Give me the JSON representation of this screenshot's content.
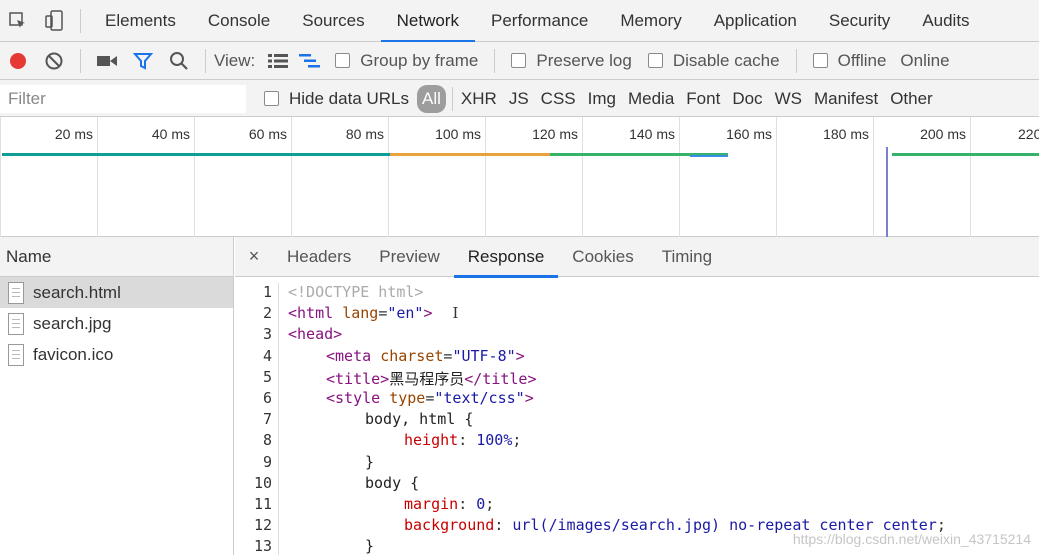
{
  "tabs": [
    "Elements",
    "Console",
    "Sources",
    "Network",
    "Performance",
    "Memory",
    "Application",
    "Security",
    "Audits"
  ],
  "active_tab": "Network",
  "toolbar": {
    "view_label": "View:",
    "group_by_frame": "Group by frame",
    "preserve_log": "Preserve log",
    "disable_cache": "Disable cache",
    "offline": "Offline",
    "throttle": "Online"
  },
  "filter": {
    "placeholder": "Filter",
    "hide_data_urls": "Hide data URLs",
    "types": [
      "All",
      "XHR",
      "JS",
      "CSS",
      "Img",
      "Media",
      "Font",
      "Doc",
      "WS",
      "Manifest",
      "Other"
    ]
  },
  "timeline": {
    "ticks": [
      "20 ms",
      "40 ms",
      "60 ms",
      "80 ms",
      "100 ms",
      "120 ms",
      "140 ms",
      "160 ms",
      "180 ms",
      "200 ms",
      "220"
    ]
  },
  "requests": {
    "header": "Name",
    "items": [
      "search.html",
      "search.jpg",
      "favicon.ico"
    ],
    "selected": "search.html"
  },
  "detail": {
    "close": "×",
    "tabs": [
      "Headers",
      "Preview",
      "Response",
      "Cookies",
      "Timing"
    ],
    "active": "Response",
    "line_numbers": [
      "1",
      "2",
      "3",
      "4",
      "5",
      "6",
      "7",
      "8",
      "9",
      "10",
      "11",
      "12",
      "13"
    ]
  },
  "code": {
    "l1": "<!DOCTYPE html>",
    "l2_tag": "<html ",
    "l2_attr": "lang",
    "l2_eq": "=",
    "l2_val": "\"en\"",
    "l2_end": ">",
    "l3": "<head>",
    "l4_tag": "<meta ",
    "l4_attr": "charset",
    "l4_eq": "=",
    "l4_val": "\"UTF-8\"",
    "l4_end": ">",
    "l5_open": "<title>",
    "l5_text": "黑马程序员",
    "l5_close": "</title>",
    "l6_tag": "<style ",
    "l6_attr": "type",
    "l6_eq": "=",
    "l6_val": "\"text/css\"",
    "l6_end": ">",
    "l7": "body, html {",
    "l8_prop": "height",
    "l8_colon": ": ",
    "l8_val": "100%",
    "l8_semi": ";",
    "l9": "}",
    "l10": "body {",
    "l11_prop": "margin",
    "l11_colon": ": ",
    "l11_val": "0",
    "l11_semi": ";",
    "l12_prop": "background",
    "l12_colon": ": ",
    "l12_val": "url(/images/search.jpg) no-repeat center center",
    "l12_semi": ";",
    "l13": "}"
  },
  "watermark": "https://blog.csdn.net/weixin_43715214",
  "colors": {
    "accent": "#1a73e8",
    "record": "#e53935",
    "filter_active": "#1a73e8"
  }
}
